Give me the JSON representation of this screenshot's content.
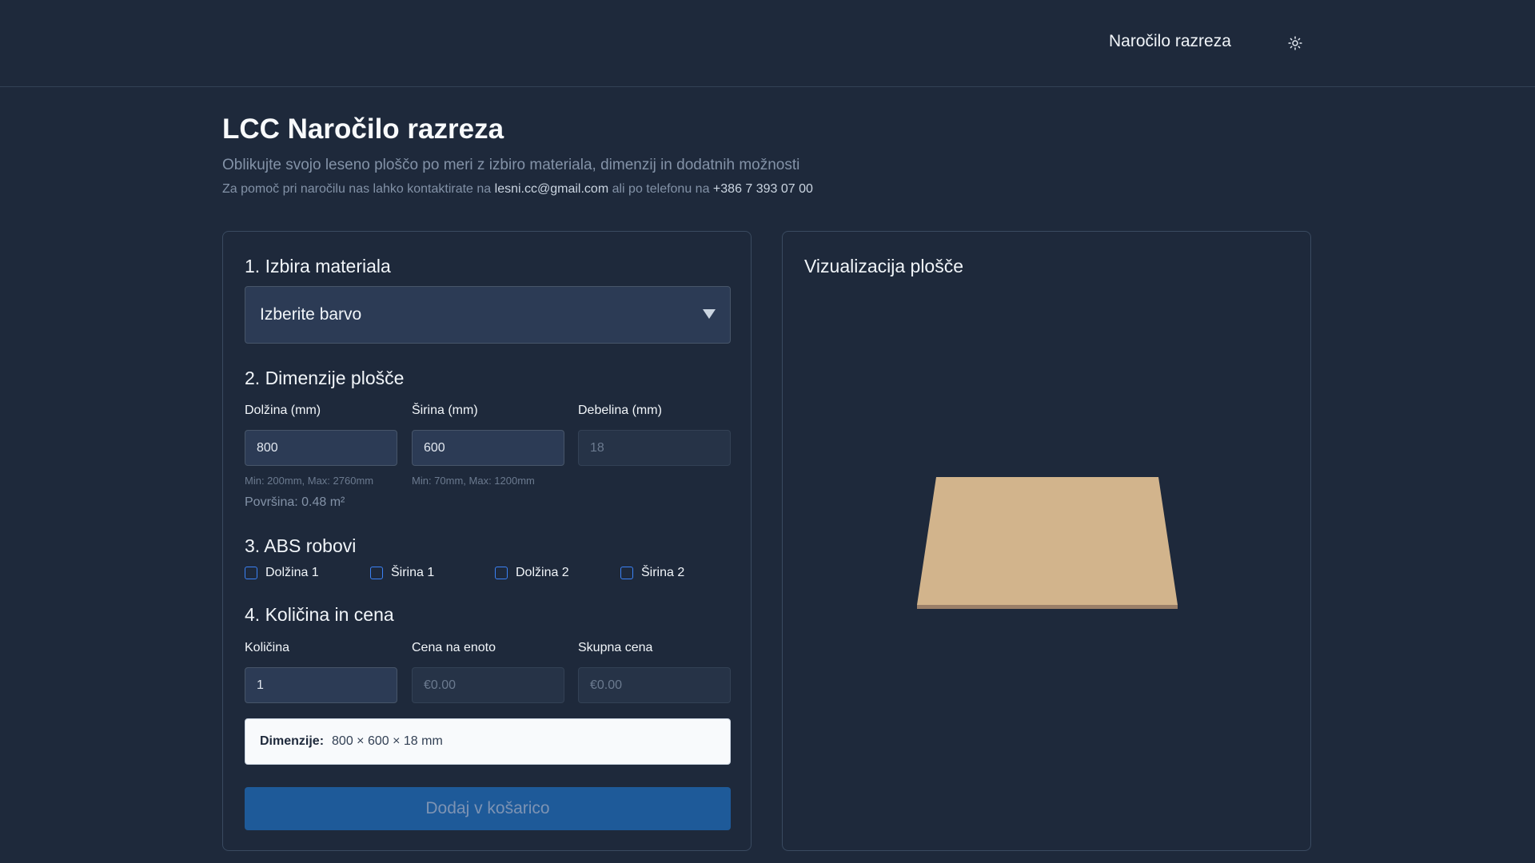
{
  "nav": {
    "order_link": "Naročilo razreza",
    "theme_icon": "sun-icon"
  },
  "header": {
    "title": "LCC Naročilo razreza",
    "subtitle": "Oblikujte svojo leseno ploščo po meri z izbiro materiala, dimenzij in dodatnih možnosti",
    "contact_prefix": "Za pomoč pri naročilu nas lahko kontaktirate na",
    "email": "lesni.cc@gmail.com",
    "contact_middle": "ali po telefonu na",
    "phone": "+386 7 393 07 00"
  },
  "material": {
    "title": "1. Izbira materiala",
    "select_value": "Izberite barvo"
  },
  "dimensions": {
    "title": "2. Dimenzije plošče",
    "length_label": "Dolžina (mm)",
    "length_value": "800",
    "length_hint": "Min: 200mm, Max: 2760mm",
    "width_label": "Širina (mm)",
    "width_value": "600",
    "width_hint": "Min: 70mm, Max: 1200mm",
    "thickness_label": "Debelina (mm)",
    "thickness_value": "18",
    "area": "Površina: 0.48 m²"
  },
  "abs_edges": {
    "title": "3. ABS robovi",
    "options": [
      "Dolžina 1",
      "Širina 1",
      "Dolžina 2",
      "Širina 2"
    ],
    "checked": [
      false,
      false,
      false,
      false
    ]
  },
  "quantity": {
    "title": "4. Količina in cena",
    "qty_label": "Količina",
    "qty_value": "1",
    "unit_price_label": "Cena na enoto",
    "unit_price_value": "€0.00",
    "total_label": "Skupna cena",
    "total_value": "€0.00"
  },
  "summary": {
    "label": "Dimenzije:",
    "value": "800 × 600 × 18 mm"
  },
  "cart_button": "Dodaj v košarico",
  "visualization": {
    "title": "Vizualizacija plošče",
    "board_color": "#d2b48c",
    "board_edge_color": "#9a7f68"
  }
}
